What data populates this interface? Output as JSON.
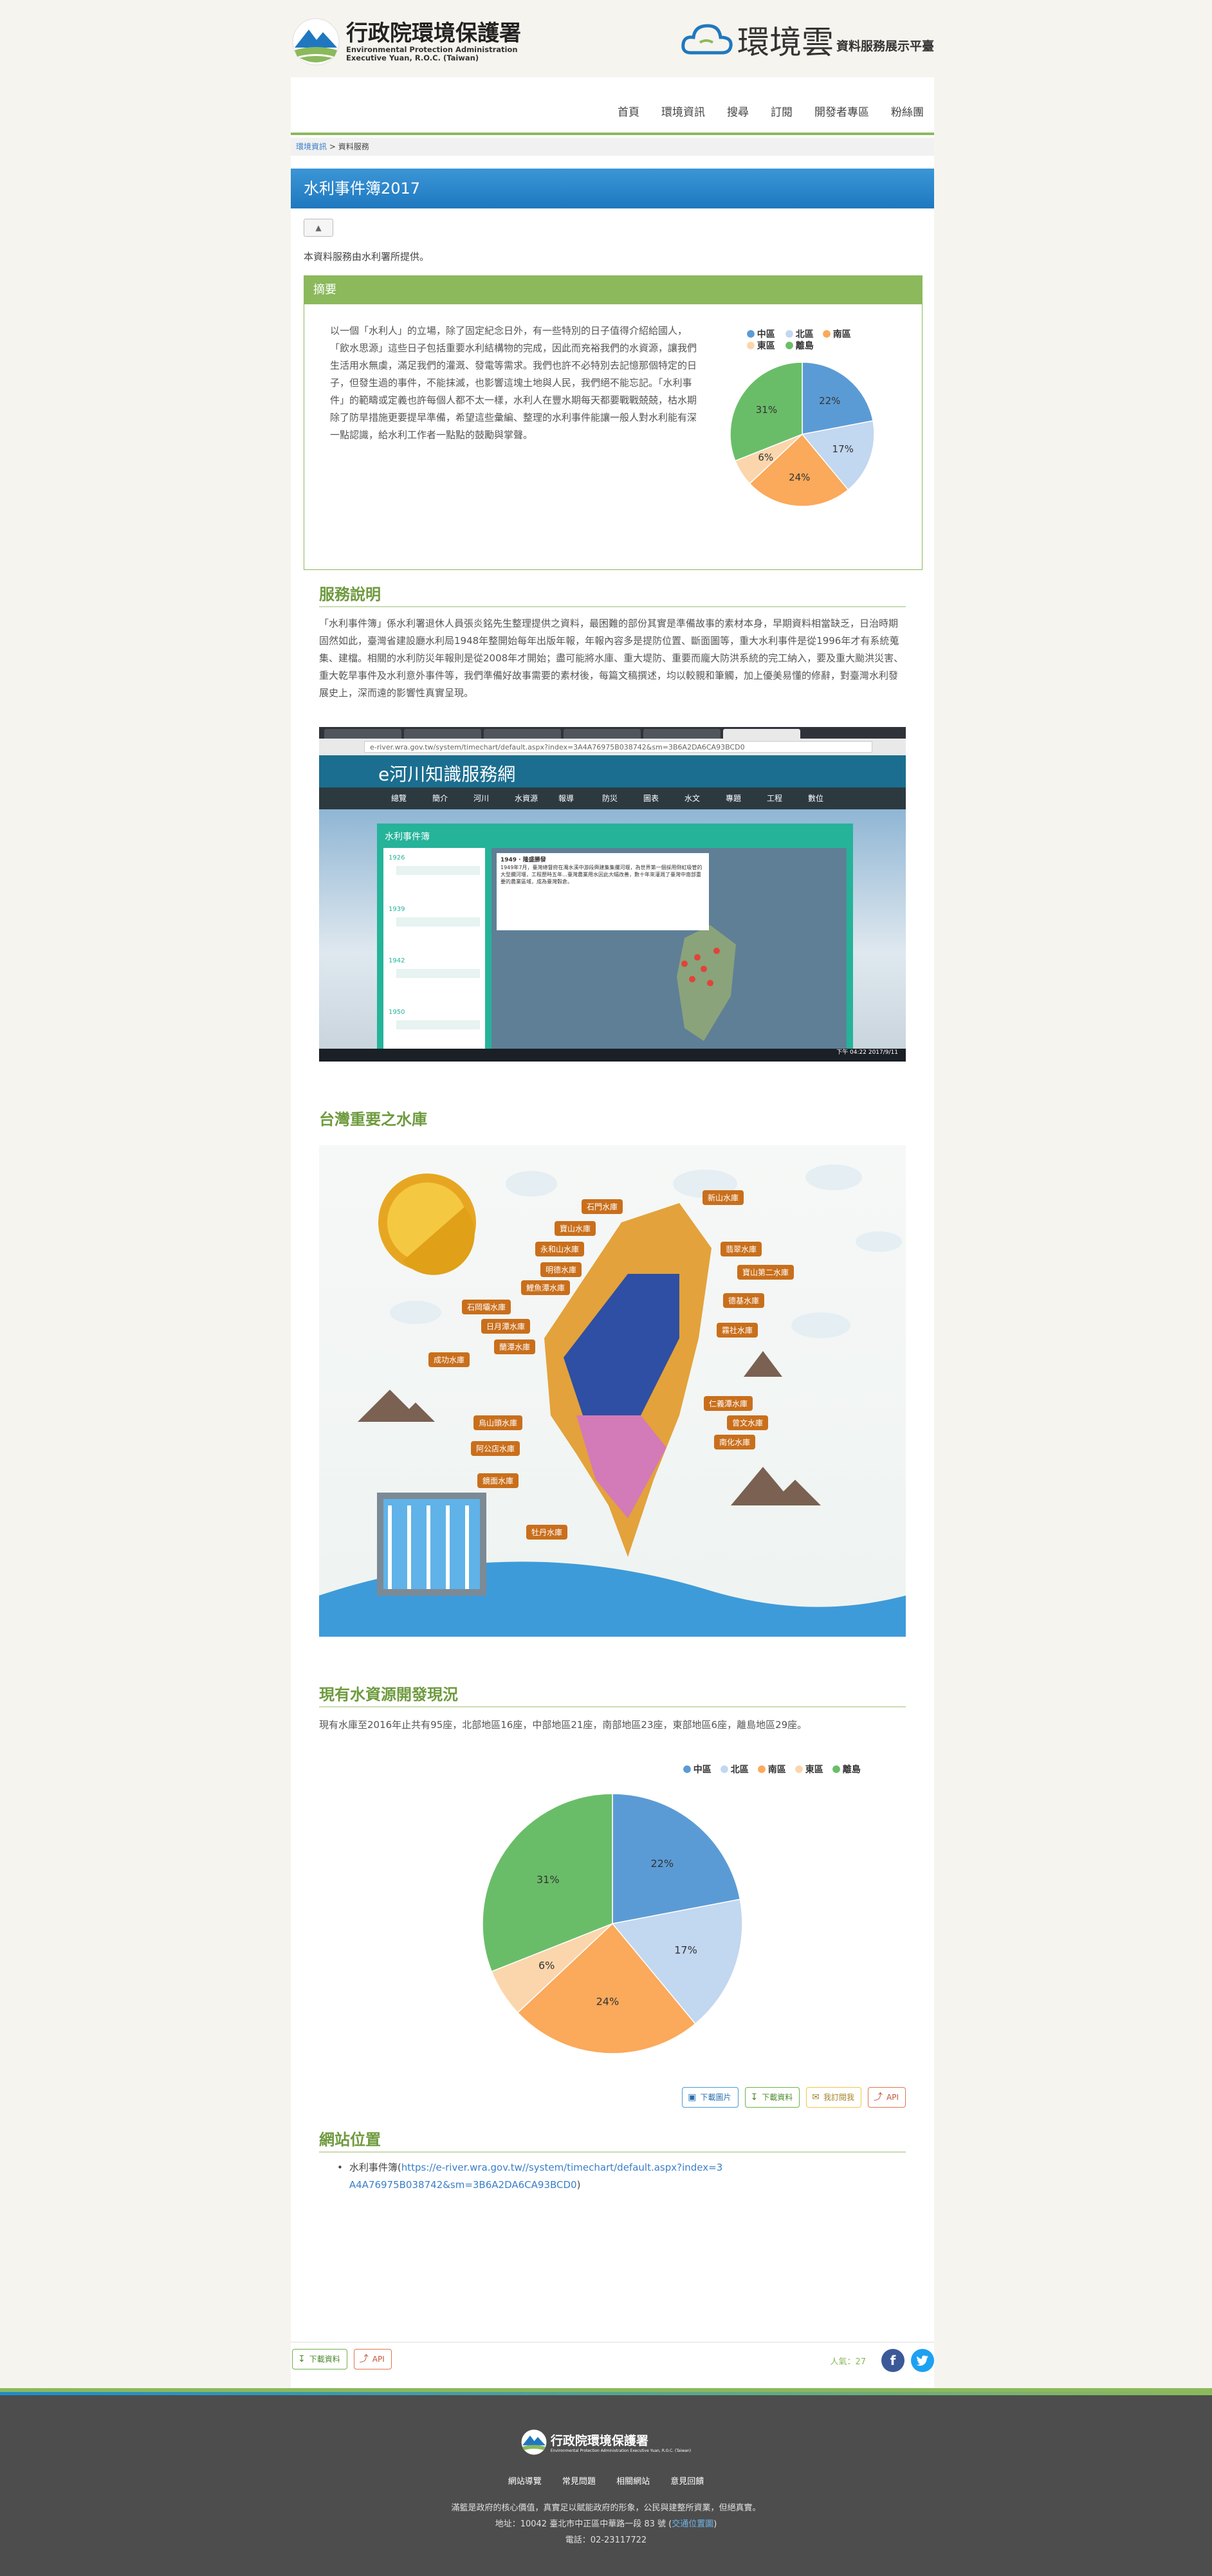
{
  "header": {
    "epa_logo_zh": "行政院環境保護署",
    "epa_logo_en1": "Environmental Protection Administration",
    "epa_logo_en2": "Executive Yuan, R.O.C. (Taiwan)",
    "cloud_logo_zh": "環境雲",
    "cloud_logo_sub": "資料服務展示平臺"
  },
  "nav": {
    "items": [
      "首頁",
      "環境資訊",
      "搜尋",
      "訂閱",
      "開發者專區",
      "粉絲團"
    ]
  },
  "breadcrumb": {
    "link": "環境資訊",
    "sep": " > ",
    "current": "資料服務"
  },
  "page_title": "水利事件簿2017",
  "small_button": "▲",
  "provider_text": "本資料服務由水利署所提供。",
  "summary": {
    "heading": "摘要",
    "text": "以一個「水利人」的立場，除了固定紀念日外，有一些特別的日子值得介紹給國人，「飲水思源」這些日子包括重要水利結構物的完成，因此而充裕我們的水資源，讓我們生活用水無虞，滿足我們的灌溉、發電等需求。我們也許不必特別去記憶那個特定的日子，但發生過的事件，不能抹滅，也影響這塊土地與人民，我們絕不能忘記。「水利事件」的範疇或定義也許每個人都不太一樣，水利人在豐水期每天都要戰戰兢兢，枯水期除了防旱措施更要提早準備，希望這些彙編、整理的水利事件能讓一般人對水利能有深一點認識，給水利工作者一點點的鼓勵與掌聲。"
  },
  "service": {
    "title": "服務說明",
    "text": "「水利事件簿」係水利署退休人員張炎銘先生整理提供之資料，最困難的部份其實是準備故事的素材本身，早期資料相當缺乏，日治時期固然如此，臺灣省建設廳水利局1948年整開始每年出版年報，年報內容多是提防位置、斷面圖等，重大水利事件是從1996年才有系統蒐集、建檔。相關的水利防災年報則是從2008年才開始；盡可能將水庫、重大堤防、重要而龐大防洪系統的完工納入，要及重大颱洪災害、重大乾旱事件及水利意外事件等，我們準備好故事需要的素材後，每篇文稿撰述，均以較親和筆觸，加上優美易懂的修辭，對臺灣水利發展史上，深而遠的影響性真實呈現。"
  },
  "screenshot": {
    "address": "e-river.wra.gov.tw/system/timechart/default.aspx?index=3A4A76975B038742&sm=3B6A2DA6CA93BCD0",
    "site_name": "e河川知識服務網",
    "site_nav": [
      "總覽",
      "簡介",
      "河川",
      "水資源",
      "報導",
      "防災",
      "圖表",
      "水文",
      "專題",
      "工程",
      "數位"
    ],
    "panel_label": "水利事件簿",
    "popup_title": "1949 · 隆盛勝發",
    "popup_text": "1949年7月，臺灣總督府在濁水溪中游段興建集集攔河堰，為世界第一個採用倒虹吸管的大型攔河堰，工程歷時五年…臺灣農業用水因此大幅改善，數十年來灌溉了臺灣中南部重要的農業區域，成為臺灣穀倉。",
    "timeline": [
      "1926",
      "1939",
      "1942",
      "1950"
    ],
    "clock": "下午 04:22 2017/9/11"
  },
  "reservoirs": {
    "title": "台灣重要之水庫",
    "labels": [
      "石門水庫",
      "新山水庫",
      "翡翠水庫",
      "寶山水庫",
      "永和山水庫",
      "明德水庫",
      "鯉魚潭水庫",
      "寶山第二水庫",
      "德基水庫",
      "霧社水庫",
      "石岡壩水庫",
      "日月潭水庫",
      "成功水庫",
      "蘭潭水庫",
      "仁義潭水庫",
      "烏山頭水庫",
      "曾文水庫",
      "南化水庫",
      "阿公店水庫",
      "鏡面水庫",
      "牡丹水庫"
    ]
  },
  "development": {
    "title": "現有水資源開發現況",
    "text": "現有水庫至2016年止共有95座，北部地區16座，中部地區21座，南部地區23座，東部地區6座，離島地區29座。"
  },
  "chart_data": [
    {
      "type": "pie",
      "legend": [
        "中區",
        "北區",
        "南區",
        "東區",
        "離島"
      ],
      "labels": [
        "中區",
        "北區",
        "南區",
        "東區",
        "離島"
      ],
      "values": [
        22,
        17,
        24,
        6,
        31
      ],
      "value_labels": [
        "22%",
        "17%",
        "24%",
        "6%",
        "31%"
      ],
      "colors": [
        "#5b9bd5",
        "#c2d7f0",
        "#fba95a",
        "#fbd6ac",
        "#6abd68"
      ],
      "legend_position": "top"
    },
    {
      "type": "pie",
      "legend": [
        "中區",
        "北區",
        "南區",
        "東區",
        "離島"
      ],
      "labels": [
        "中區",
        "北區",
        "南區",
        "東區",
        "離島"
      ],
      "values": [
        22,
        17,
        24,
        6,
        31
      ],
      "value_labels": [
        "22%",
        "17%",
        "24%",
        "6%",
        "31%"
      ],
      "colors": [
        "#5b9bd5",
        "#c2d7f0",
        "#fba95a",
        "#fbd6ac",
        "#6abd68"
      ],
      "legend_position": "top-right"
    }
  ],
  "buttons": {
    "download_image": "下載圖片",
    "download_data": "下載資料",
    "subscribe": "我訂閱我",
    "api": "API"
  },
  "website": {
    "title": "網站位置",
    "item_prefix": "水利事件簿(",
    "url": "https://e-river.wra.gov.tw//system/timechart/default.aspx?index=3A4A76975B038742&sm=3B6A2DA6CA93BCD0",
    "item_suffix": ")"
  },
  "bottom": {
    "download_data": "下載資料",
    "api": "API",
    "visits": "人氣：27"
  },
  "footer": {
    "logo_zh": "行政院環境保護署",
    "logo_en": "Environmental Protection Administration Executive Yuan, R.O.C. (Taiwan)",
    "links": [
      "網站導覽",
      "常見問題",
      "相關網站",
      "意見回饋"
    ],
    "line1": "滿籃是政府的核心價值，真實足以賦能政府的形象，公民與建整所資業，但絕真實。",
    "line2_prefix": "地址：10042 臺北市中正區中華路一段 83 號 (",
    "line2_link": "交通位置圖",
    "line2_suffix": ")",
    "line3": "電話：02-23117722"
  },
  "colors": {
    "green": "#8bb95c",
    "blue": "#1f78bf",
    "footer_bg": "#4d4d4d",
    "facebook": "#3b5998",
    "twitter": "#1da1f2"
  }
}
